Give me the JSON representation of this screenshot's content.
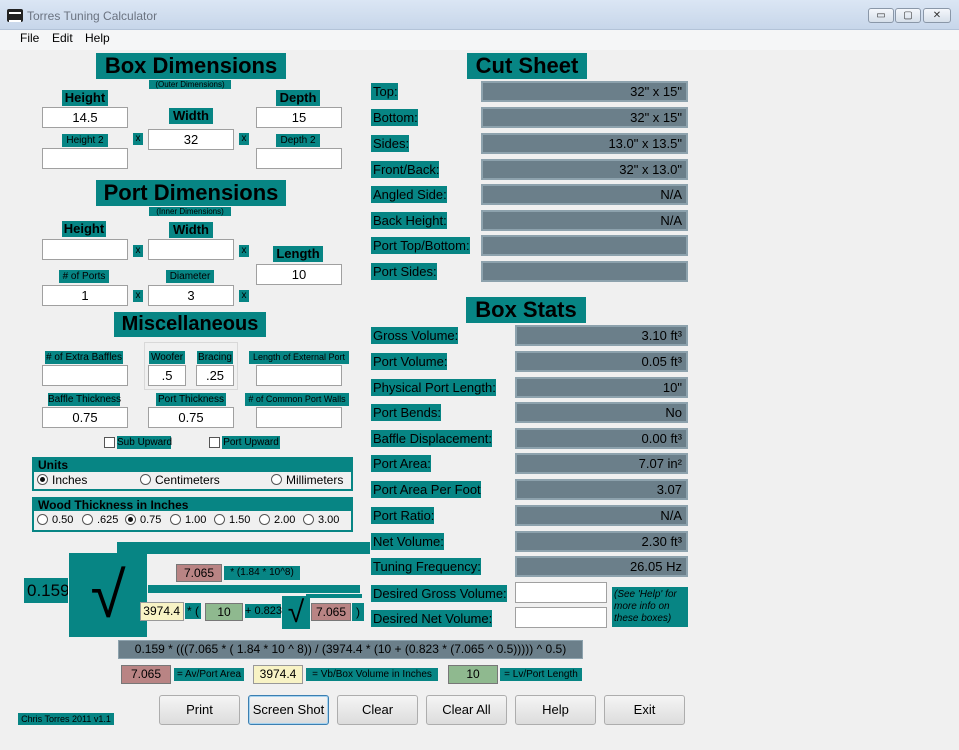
{
  "window": {
    "title": "Torres Tuning Calculator",
    "min": "▭",
    "max": "▢",
    "close": "✕"
  },
  "menu": [
    "File",
    "Edit",
    "Help"
  ],
  "box": {
    "title": "Box Dimensions",
    "subtitle": "(Outer Dimensions)",
    "height_label": "Height",
    "height": "14.5",
    "width_label": "Width",
    "width": "32",
    "depth_label": "Depth",
    "depth": "15",
    "height2_label": "Height 2",
    "height2": "",
    "depth2_label": "Depth 2",
    "depth2": "",
    "x": "x"
  },
  "port": {
    "title": "Port Dimensions",
    "subtitle": "(Inner Dimensions)",
    "height_label": "Height",
    "height": "",
    "width_label": "Width",
    "width": "",
    "length_label": "Length",
    "length": "10",
    "num_ports_label": "# of Ports",
    "num_ports": "1",
    "diameter_label": "Diameter",
    "diameter": "3"
  },
  "misc": {
    "title": "Miscellaneous",
    "extra_baffles_label": "# of Extra Baffles",
    "extra_baffles": "",
    "woofer_label": "Woofer",
    "woofer": ".5",
    "bracing_label": "Bracing",
    "bracing": ".25",
    "ext_port_label": "Length of External Port",
    "ext_port": "",
    "baffle_thickness_label": "Baffle Thickness",
    "baffle_thickness": "0.75",
    "port_thickness_label": "Port Thickness",
    "port_thickness": "0.75",
    "common_walls_label": "# of Common Port Walls",
    "common_walls": "",
    "sub_upward": "Sub Upward",
    "port_upward": "Port Upward"
  },
  "units": {
    "label": "Units",
    "options": [
      "Inches",
      "Centimeters",
      "Millimeters"
    ],
    "selected": "Inches"
  },
  "wood": {
    "label": "Wood Thickness in Inches",
    "options": [
      "0.50",
      ".625",
      "0.75",
      "1.00",
      "1.50",
      "2.00",
      "3.00"
    ],
    "selected": "0.75"
  },
  "formula": {
    "coef": "0.159",
    "av": "7.065",
    "av_mult": "* (1.84 * 10^8)",
    "vb": "3974.4",
    "open": "* (",
    "lv": "10",
    "plus": "+ 0.823",
    "av2": "7.065",
    "close": ")",
    "full": "0.159 * (((7.065 * ( 1.84 * 10 ^ 8)) / (3974.4 * (10 + (0.823 * (7.065 ^ 0.5))))) ^ 0.5)",
    "legend_av": "7.065",
    "legend_av_text": "= Av/Port Area",
    "legend_vb": "3974.4",
    "legend_vb_text": "= Vb/Box Volume in Inches",
    "legend_lv": "10",
    "legend_lv_text": "= Lv/Port Length"
  },
  "cut_sheet": {
    "title": "Cut Sheet",
    "rows": [
      {
        "label": "Top:",
        "value": "32\" x 15\""
      },
      {
        "label": "Bottom:",
        "value": "32\" x 15\""
      },
      {
        "label": "Sides:",
        "value": "13.0\" x 13.5\""
      },
      {
        "label": "Front/Back:",
        "value": "32\" x 13.0\""
      },
      {
        "label": "Angled Side:",
        "value": "N/A"
      },
      {
        "label": "Back Height:",
        "value": "N/A"
      },
      {
        "label": "Port Top/Bottom:",
        "value": ""
      },
      {
        "label": "Port Sides:",
        "value": ""
      }
    ]
  },
  "stats": {
    "title": "Box Stats",
    "rows": [
      {
        "label": "Gross Volume:",
        "value": "3.10 ft³"
      },
      {
        "label": "Port Volume:",
        "value": "0.05 ft³"
      },
      {
        "label": "Physical Port Length:",
        "value": "10\""
      },
      {
        "label": "Port Bends:",
        "value": "No"
      },
      {
        "label": "Baffle Displacement:",
        "value": "0.00 ft³"
      },
      {
        "label": "Port Area:",
        "value": "7.07 in²"
      },
      {
        "label": "Port Area Per Foot",
        "value": "3.07"
      },
      {
        "label": "Port Ratio:",
        "value": "N/A"
      },
      {
        "label": "Net Volume:",
        "value": "2.30 ft³"
      },
      {
        "label": "Tuning Frequency:",
        "value": "26.05 Hz"
      }
    ],
    "desired_gross_label": "Desired Gross Volume:",
    "desired_gross": "",
    "desired_net_label": "Desired Net Volume:",
    "desired_net": "",
    "help_note": "(See 'Help' for more info on these boxes)"
  },
  "buttons": [
    "Print",
    "Screen Shot",
    "Clear",
    "Clear All",
    "Help",
    "Exit"
  ],
  "credit": "Chris Torres 2011 v1.1"
}
